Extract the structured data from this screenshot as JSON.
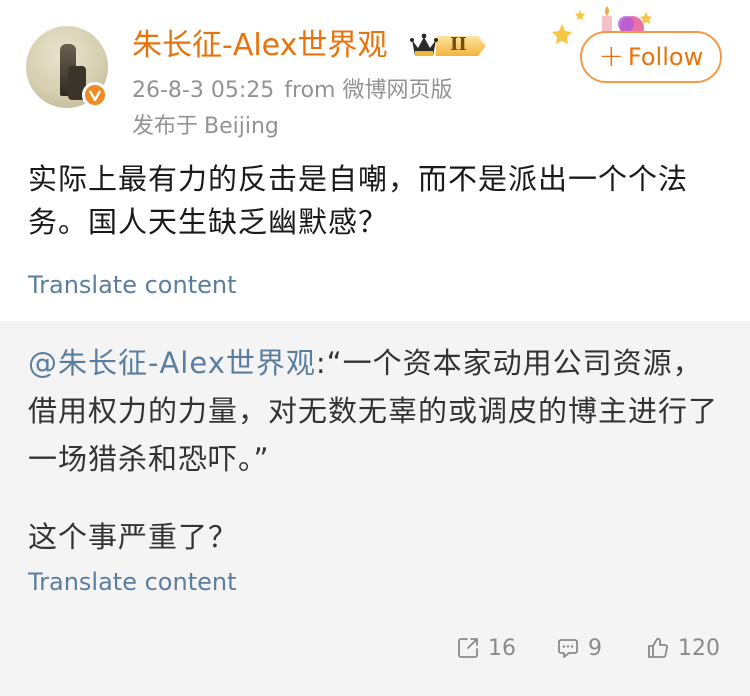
{
  "header": {
    "username": "朱长征-Alex世界观",
    "badge_level": "II",
    "timestamp": "26-8-3 05:25",
    "source": "from 微博网页版",
    "location_prefix": "发布于",
    "location": "Beijing",
    "follow_label": "Follow"
  },
  "post": {
    "text": "实际上最有力的反击是自嘲，而不是派出一个个法务。国人天生缺乏幽默感？",
    "translate_label": "Translate content"
  },
  "retweet": {
    "mention": "@朱长征-Alex世界观",
    "text": ":“一个资本家动用公司资源，借用权力的力量，对无数无辜的或调皮的博主进行了一场猎杀和恐吓。”",
    "text2": "这个事严重了？",
    "translate_label": "Translate content"
  },
  "actions": {
    "reposts": "16",
    "comments": "9",
    "likes": "120"
  },
  "colors": {
    "accent": "#e8730c",
    "link": "#5b7e9e",
    "meta": "#939393",
    "retweet_bg": "#f4f4f4"
  },
  "icons": {
    "verify": "verified-badge-icon",
    "crown": "crown-icon",
    "repost": "repost-icon",
    "comment": "comment-icon",
    "like": "thumbs-up-icon"
  }
}
